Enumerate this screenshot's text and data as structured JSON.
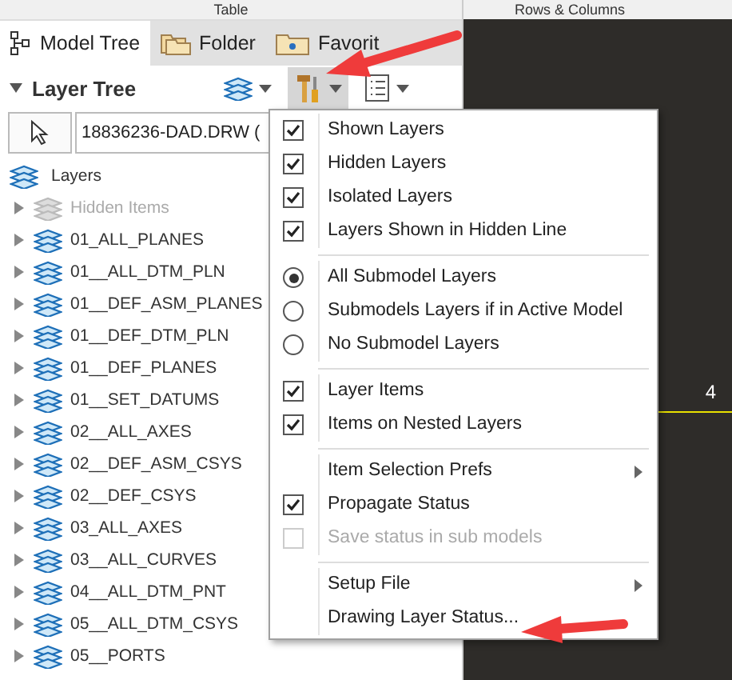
{
  "top_strip": {
    "left_label": "Table",
    "right_label": "Rows & Columns"
  },
  "tabs": [
    {
      "kind": "tree",
      "label": "Model Tree",
      "selected": true
    },
    {
      "kind": "folder",
      "label": "Folder",
      "selected": false
    },
    {
      "kind": "favorites",
      "label": "Favorit",
      "selected": false
    }
  ],
  "layer_tree": {
    "title": "Layer Tree",
    "expanded": true,
    "model_field": "18836236-DAD.DRW (",
    "root": "Layers",
    "items": [
      {
        "label": "Hidden Items",
        "disabled": true,
        "expanded": false
      },
      {
        "label": "01_ALL_PLANES",
        "disabled": false,
        "expanded": false
      },
      {
        "label": "01__ALL_DTM_PLN",
        "disabled": false,
        "expanded": false
      },
      {
        "label": "01__DEF_ASM_PLANES",
        "disabled": false,
        "expanded": false
      },
      {
        "label": "01__DEF_DTM_PLN",
        "disabled": false,
        "expanded": false
      },
      {
        "label": "01__DEF_PLANES",
        "disabled": false,
        "expanded": false
      },
      {
        "label": "01__SET_DATUMS",
        "disabled": false,
        "expanded": false
      },
      {
        "label": "02__ALL_AXES",
        "disabled": false,
        "expanded": false
      },
      {
        "label": "02__DEF_ASM_CSYS",
        "disabled": false,
        "expanded": false
      },
      {
        "label": "02__DEF_CSYS",
        "disabled": false,
        "expanded": false
      },
      {
        "label": "03_ALL_AXES",
        "disabled": false,
        "expanded": false
      },
      {
        "label": "03__ALL_CURVES",
        "disabled": false,
        "expanded": false
      },
      {
        "label": "04__ALL_DTM_PNT",
        "disabled": false,
        "expanded": false
      },
      {
        "label": "05__ALL_DTM_CSYS",
        "disabled": false,
        "expanded": false
      },
      {
        "label": "05__PORTS",
        "disabled": false,
        "expanded": false
      }
    ]
  },
  "menu": [
    {
      "kind": "check",
      "label": "Shown Layers",
      "checked": true,
      "disabled": false
    },
    {
      "kind": "check",
      "label": "Hidden Layers",
      "checked": true,
      "disabled": false
    },
    {
      "kind": "check",
      "label": "Isolated Layers",
      "checked": true,
      "disabled": false
    },
    {
      "kind": "check",
      "label": "Layers Shown in Hidden Line",
      "checked": true,
      "disabled": false
    },
    {
      "kind": "separator"
    },
    {
      "kind": "radio",
      "label": "All Submodel Layers",
      "selected": true
    },
    {
      "kind": "radio",
      "label": "Submodels Layers if in Active Model",
      "selected": false
    },
    {
      "kind": "radio",
      "label": "No Submodel Layers",
      "selected": false
    },
    {
      "kind": "separator"
    },
    {
      "kind": "check",
      "label": "Layer Items",
      "checked": true,
      "disabled": false
    },
    {
      "kind": "check",
      "label": "Items on Nested Layers",
      "checked": true,
      "disabled": false
    },
    {
      "kind": "separator"
    },
    {
      "kind": "submenu",
      "label": "Item Selection Prefs"
    },
    {
      "kind": "check",
      "label": "Propagate Status",
      "checked": true,
      "disabled": false
    },
    {
      "kind": "check",
      "label": "Save status in sub models",
      "checked": false,
      "disabled": true
    },
    {
      "kind": "separator"
    },
    {
      "kind": "submenu",
      "label": "Setup File"
    },
    {
      "kind": "action",
      "label": "Drawing Layer Status..."
    }
  ],
  "canvas": {
    "dimension_label": "4"
  }
}
